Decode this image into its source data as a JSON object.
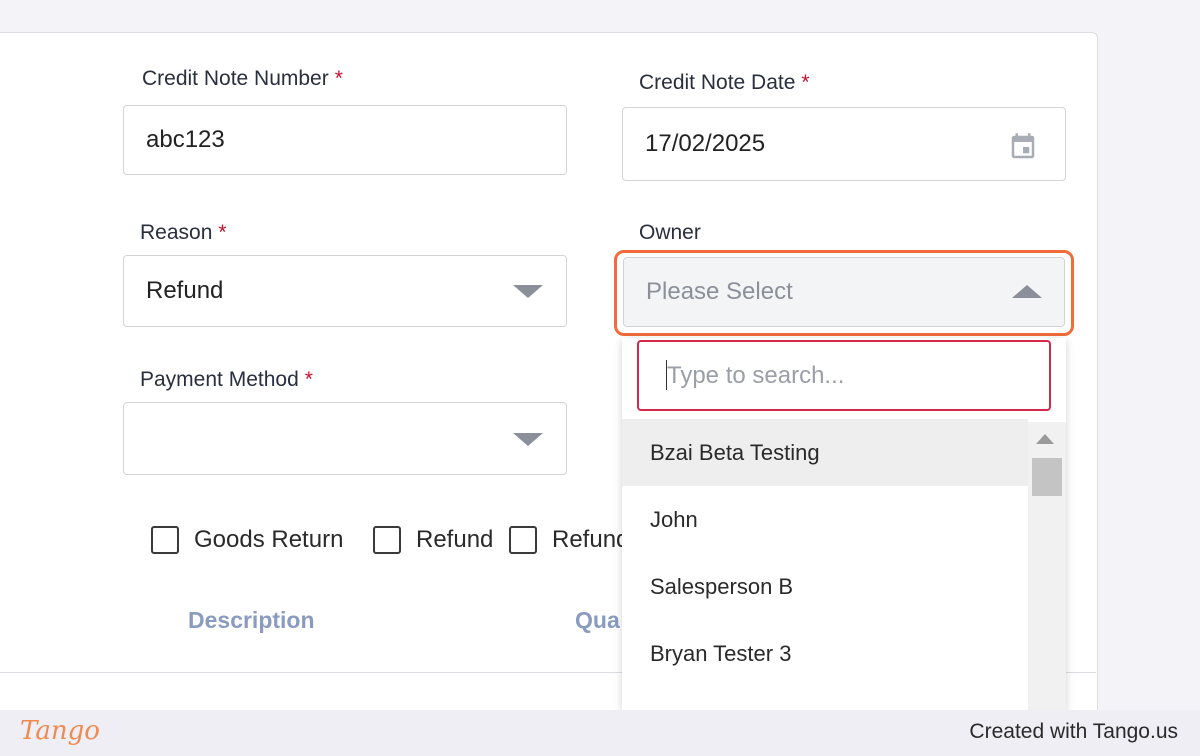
{
  "form": {
    "credit_note_number": {
      "label": "Credit Note Number",
      "required": "*",
      "value": "abc123"
    },
    "credit_note_date": {
      "label": "Credit Note Date",
      "required": "*",
      "value": "17/02/2025"
    },
    "reason": {
      "label": "Reason",
      "required": "*",
      "value": "Refund"
    },
    "owner": {
      "label": "Owner",
      "placeholder": "Please Select"
    },
    "payment_method": {
      "label": "Payment Method",
      "required": "*",
      "value": ""
    }
  },
  "dropdown": {
    "search_placeholder": "Type to search...",
    "options": [
      "Bzai Beta Testing",
      "John",
      "Salesperson B",
      "Bryan Tester 3"
    ]
  },
  "checkboxes": [
    "Goods Return",
    "Refund",
    "Refund"
  ],
  "table": {
    "columns": [
      "Description",
      "Qua"
    ]
  },
  "footer": {
    "logo": "Tango",
    "created_with": "Created with Tango.us"
  },
  "colors": {
    "highlight": "#f26b3a",
    "required": "#c8102e",
    "search_border": "#d42a4a",
    "column_header": "#8a9bc0"
  },
  "icons": {
    "date_picker": "calendar-icon"
  }
}
